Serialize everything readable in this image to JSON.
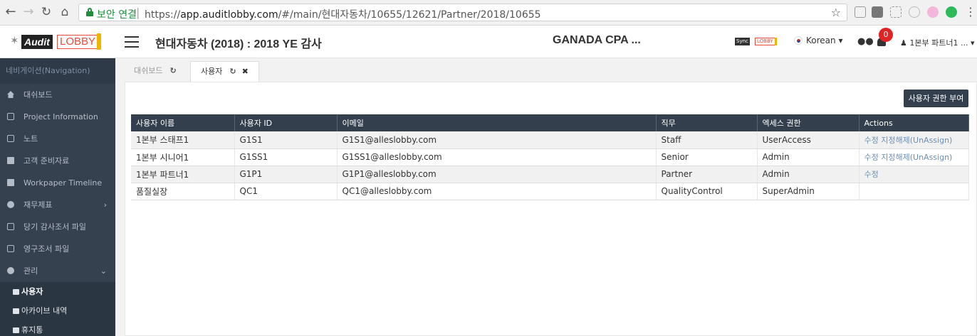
{
  "browser": {
    "secure_label": "보안 연결",
    "url_scheme": "https://",
    "url_host": "app.auditlobby.com",
    "url_path": "/#/main/현대자동차/10655/12621/Partner/2018/10655",
    "back_icon": "arrow-left-icon",
    "forward_icon": "arrow-right-icon",
    "reload_icon": "reload-icon",
    "home_icon": "home-icon"
  },
  "header": {
    "logo_audit": "Audit",
    "logo_lobby": "LOBBY",
    "engagement_title": "현대자동차 (2018) : 2018 YE 감사",
    "firm_name": "GANADA CPA ...",
    "sync_label": "Sync",
    "sync_lobby": "LOBBY",
    "language": "Korean",
    "notification_count": "0",
    "user_name": "1본부 파트너1 ..."
  },
  "sidebar": {
    "heading": "네비게이션(Navigation)",
    "items": [
      {
        "label": "대쉬보드"
      },
      {
        "label": "Project Information"
      },
      {
        "label": "노트"
      },
      {
        "label": "고객 준비자료"
      },
      {
        "label": "Workpaper Timeline"
      },
      {
        "label": "재무제표"
      },
      {
        "label": "당기 감사조서 파일"
      },
      {
        "label": "영구조서 파일"
      },
      {
        "label": "관리"
      }
    ],
    "sub_items": [
      {
        "label": "사용자"
      },
      {
        "label": "아카이브 내역"
      },
      {
        "label": "휴지통"
      }
    ]
  },
  "tabs": [
    {
      "label": "대쉬보드"
    },
    {
      "label": "사용자"
    }
  ],
  "toolbar": {
    "grant_button": "사용자 권한 부여"
  },
  "table": {
    "headers": [
      "사용자 이름",
      "사용자 ID",
      "이메일",
      "직무",
      "엑세스 권한",
      "Actions"
    ],
    "rows": [
      {
        "name": "1본부 스태프1",
        "id": "G1S1",
        "email": "G1S1@alleslobby.com",
        "role": "Staff",
        "access": "UserAccess",
        "edit": "수정",
        "unassign": "지정해제(UnAssign)"
      },
      {
        "name": "1본부 시니어1",
        "id": "G1SS1",
        "email": "G1SS1@alleslobby.com",
        "role": "Senior",
        "access": "Admin",
        "edit": "수정",
        "unassign": "지정해제(UnAssign)"
      },
      {
        "name": "1본부 파트너1",
        "id": "G1P1",
        "email": "G1P1@alleslobby.com",
        "role": "Partner",
        "access": "Admin",
        "edit": "수정",
        "unassign": ""
      },
      {
        "name": "품질실장",
        "id": "QC1",
        "email": "QC1@alleslobby.com",
        "role": "QualityControl",
        "access": "SuperAdmin",
        "edit": "",
        "unassign": ""
      }
    ]
  }
}
